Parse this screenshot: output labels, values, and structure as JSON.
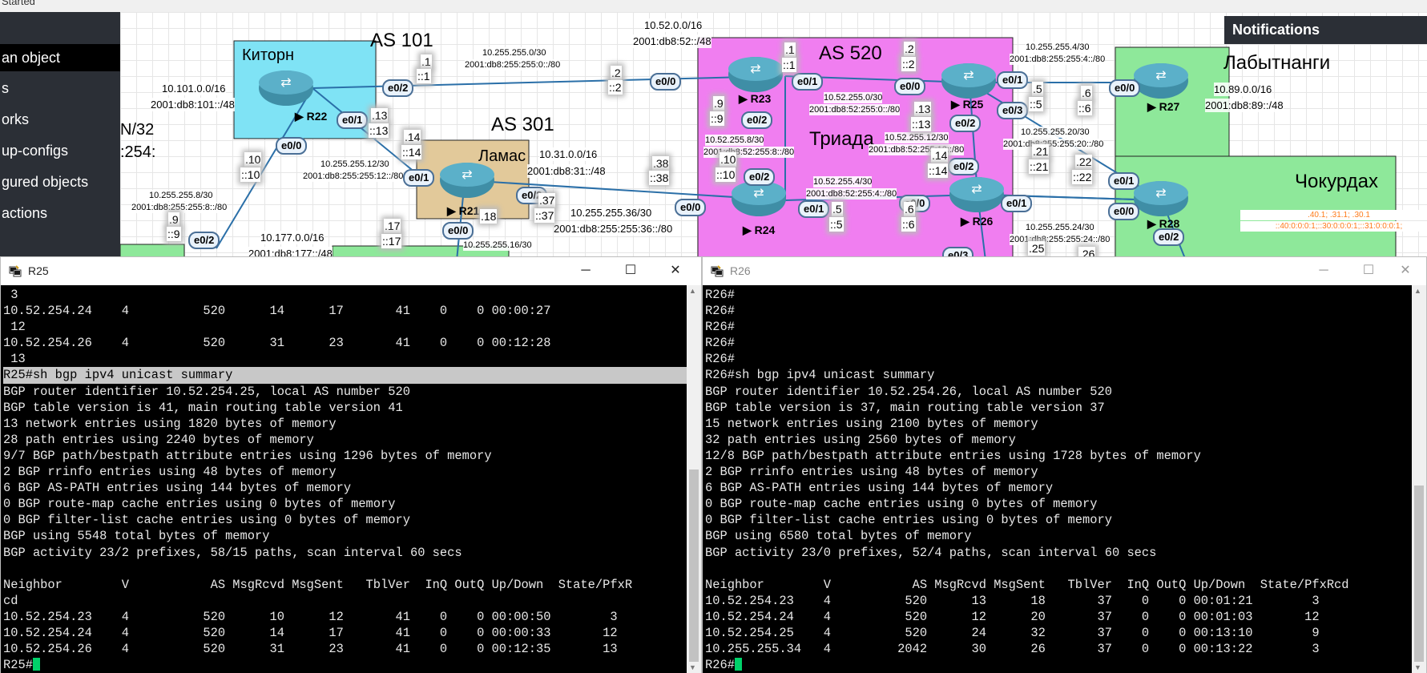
{
  "top_strip": {
    "label": "Started"
  },
  "sidebar": {
    "items": [
      {
        "label": "an object",
        "active": true
      },
      {
        "label": "s",
        "active": false
      },
      {
        "label": "orks",
        "active": false
      },
      {
        "label": "up-configs",
        "active": false
      },
      {
        "label": "gured objects",
        "active": false
      },
      {
        "label": "actions",
        "active": false
      }
    ]
  },
  "notifications": {
    "title": "Notifications"
  },
  "topology": {
    "areas": {
      "kitorn": "Киторн",
      "as101": "AS 101",
      "as301": "AS 301",
      "lamas": "Ламас",
      "as520": "AS 520",
      "triada": "Триада",
      "labytnangi": "Лабытнанги",
      "chokurdakh": "Чокурдах"
    },
    "routers": {
      "r22": "▶ R22",
      "r23": "▶ R23",
      "r21": "▶ R21",
      "r24": "▶ R24",
      "r25": "▶ R25",
      "r26": "▶ R26",
      "r27": "▶ R27",
      "r28": "▶ R28"
    },
    "interfaces": {
      "r22_e02": "e0/2",
      "r22_e01": "e0/1",
      "r22_e00": "e0/0",
      "r23_e00": "e0/0",
      "r23_e01": "e0/1",
      "r23_e02": "e0/2",
      "r25_e00": "e0/0",
      "r25_e01": "e0/1",
      "r25_e02": "e0/2",
      "r25_e03": "e0/3",
      "r21_e01": "e0/1",
      "r21_e02": "e0/2",
      "r21_e00": "e0/0",
      "r24_e00": "e0/0",
      "r24_e01": "e0/1",
      "r24_e02": "e0/2",
      "r26_e00": "e0/0",
      "r26_e01": "e0/1",
      "r26_e02": "e0/2",
      "r26_e03": "e0/3",
      "r27_e00": "e0/0",
      "r28_e01": "e0/1",
      "r28_e00": "e0/0",
      "r28_e02": "e0/2",
      "left_e02": "e0/2"
    },
    "subnets": {
      "kitorn_v4": "10.101.0.0/16",
      "kitorn_v6": "2001:db8:101::/48",
      "link_22_23_v4": "10.255.255.0/30",
      "link_22_23_v6": "2001:db8:255:255:0::/80",
      "as520_v4": "10.52.0.0/16",
      "as520_v6": "2001:db8:52::/48",
      "lamas_v4": "10.31.0.0/16",
      "lamas_v6": "2001:db8:31::/48",
      "link_22_21_v4": "10.255.255.12/30",
      "link_22_21_v6": "2001:db8:255:255:12::/80",
      "link_8_v4": "10.255.255.8/30",
      "link_8_v6": "2001:db8:255:255:8::/80",
      "link_23_25_v4": "10.52.255.0/30",
      "link_23_25_v6": "2001:db8:52:255:0::/80",
      "link_23_24_v4": "10.52.255.8/30",
      "link_23_24_v6": "2001:db8:52:255:8::/80",
      "link_25_27_v4": "10.255.255.4/30",
      "link_25_27_v6": "2001:db8:255:255:4::/80",
      "labyt_v4": "10.89.0.0/16",
      "labyt_v6": "2001:db8:89::/48",
      "link_25_26_v4": "10.52.255.12/30",
      "link_25_26_v6": "2001:db8:52:255:12::/80",
      "link_25_28_v4": "10.255.255.20/30",
      "link_25_28_v6": "2001:db8:255:255:20::/80",
      "link_24_26_v4": "10.52.255.4/30",
      "link_24_26_v6": "2001:db8:52:255:4::/80",
      "link_21_24_v4": "10.255.255.36/30",
      "link_21_24_v6": "2001:db8:255:255:36::/80",
      "link_26_28_v4": "10.255.255.24/30",
      "link_26_28_v6": "2001:db8:255:255:24::/80",
      "bottom_v4": "10.177.0.0/16",
      "bottom_v6": "2001:db8:177::/48",
      "link_16_v4": "10.255.255.16/30",
      "left_cut_1": "N/32",
      "left_cut_2": ":254:",
      "chok_v4": ".40.1; .31.1; .30.1",
      "chok_v6": "::40:0:0:0:1;::30:0:0:0:1;::31:0:0:0:1;"
    },
    "addrs": {
      "a1": ".1",
      "a1b": "::1",
      "a2": ".2",
      "a2b": "::2",
      "a13": ".13",
      "a13b": "::13",
      "a14": ".14",
      "a14b": "::14",
      "a10": ".10",
      "a10b": "::10",
      "a9": ".9",
      "a9b": "::9",
      "a17": ".17",
      "a17b": "::17",
      "a18": ".18",
      "a37": ".37",
      "a37b": "::37",
      "a38": ".38",
      "a38b": "::38",
      "r23_1": ".1",
      "r23_1b": "::1",
      "r25_2": ".2",
      "r25_2b": "::2",
      "r23_9": ".9",
      "r23_9b": "::9",
      "r24_10": ".10",
      "r24_10b": "::10",
      "r25_13": ".13",
      "r25_13b": "::13",
      "r26_14": ".14",
      "r26_14b": "::14",
      "r24_5": ".5",
      "r24_5b": "::5",
      "r26_6": ".6",
      "r26_6b": "::6",
      "r25_5": ".5",
      "r25_5b": "::5",
      "r27_6": ".6",
      "r27_6b": "::6",
      "r25_21": ".21",
      "r25_21b": "::21",
      "r28_22": ".22",
      "r28_22b": "::22",
      "r26_25": ".25",
      "r28_26": ".26"
    }
  },
  "windows": {
    "r25": {
      "title": "R25",
      "controls": {
        "min": "─",
        "max": "☐",
        "close": "✕"
      },
      "lines": [
        " 3",
        "10.52.254.24    4          520      14      17       41    0    0 00:00:27",
        " 12",
        "10.52.254.26    4          520      31      23       41    0    0 00:12:28",
        " 13",
        "R25#sh bgp ipv4 unicast summary",
        "BGP router identifier 10.52.254.25, local AS number 520",
        "BGP table version is 41, main routing table version 41",
        "13 network entries using 1820 bytes of memory",
        "28 path entries using 2240 bytes of memory",
        "9/7 BGP path/bestpath attribute entries using 1296 bytes of memory",
        "2 BGP rrinfo entries using 48 bytes of memory",
        "6 BGP AS-PATH entries using 144 bytes of memory",
        "0 BGP route-map cache entries using 0 bytes of memory",
        "0 BGP filter-list cache entries using 0 bytes of memory",
        "BGP using 5548 total bytes of memory",
        "BGP activity 23/2 prefixes, 58/15 paths, scan interval 60 secs",
        "",
        "Neighbor        V           AS MsgRcvd MsgSent   TblVer  InQ OutQ Up/Down  State/PfxR",
        "cd",
        "10.52.254.23    4          520      10      12       41    0    0 00:00:50        3",
        "10.52.254.24    4          520      14      17       41    0    0 00:00:33       12",
        "10.52.254.26    4          520      31      23       41    0    0 00:12:35       13"
      ],
      "prompt": "R25#",
      "highlight_index": 5
    },
    "r26": {
      "title": "R26",
      "controls": {
        "min": "─",
        "max": "☐",
        "close": "✕"
      },
      "lines": [
        "R26#",
        "R26#",
        "R26#",
        "R26#",
        "R26#",
        "R26#sh bgp ipv4 unicast summary",
        "BGP router identifier 10.52.254.26, local AS number 520",
        "BGP table version is 37, main routing table version 37",
        "15 network entries using 2100 bytes of memory",
        "32 path entries using 2560 bytes of memory",
        "12/8 BGP path/bestpath attribute entries using 1728 bytes of memory",
        "2 BGP rrinfo entries using 48 bytes of memory",
        "6 BGP AS-PATH entries using 144 bytes of memory",
        "0 BGP route-map cache entries using 0 bytes of memory",
        "0 BGP filter-list cache entries using 0 bytes of memory",
        "BGP using 6580 total bytes of memory",
        "BGP activity 23/0 prefixes, 52/4 paths, scan interval 60 secs",
        "",
        "Neighbor        V           AS MsgRcvd MsgSent   TblVer  InQ OutQ Up/Down  State/PfxRcd",
        "10.52.254.23    4          520      13      18       37    0    0 00:01:21        3",
        "10.52.254.24    4          520      12      20       37    0    0 00:01:03       12",
        "10.52.254.25    4          520      24      32       37    0    0 00:13:10        9",
        "10.255.255.34   4         2042      30      26       37    0    0 00:13:22        3"
      ],
      "prompt": "R26#"
    }
  },
  "colors": {
    "kitorn_area": "#7fe3f5",
    "lamas_area": "#e2c99a",
    "as520_area": "#f07ef0",
    "green_area": "#8ee89a",
    "link": "#2a6fa8",
    "router_body": "#3f8ea6",
    "sidebar_bg": "#2b2f36",
    "terminal_bg": "#000000",
    "terminal_fg": "#e8e8e8",
    "cursor": "#00d26a"
  }
}
